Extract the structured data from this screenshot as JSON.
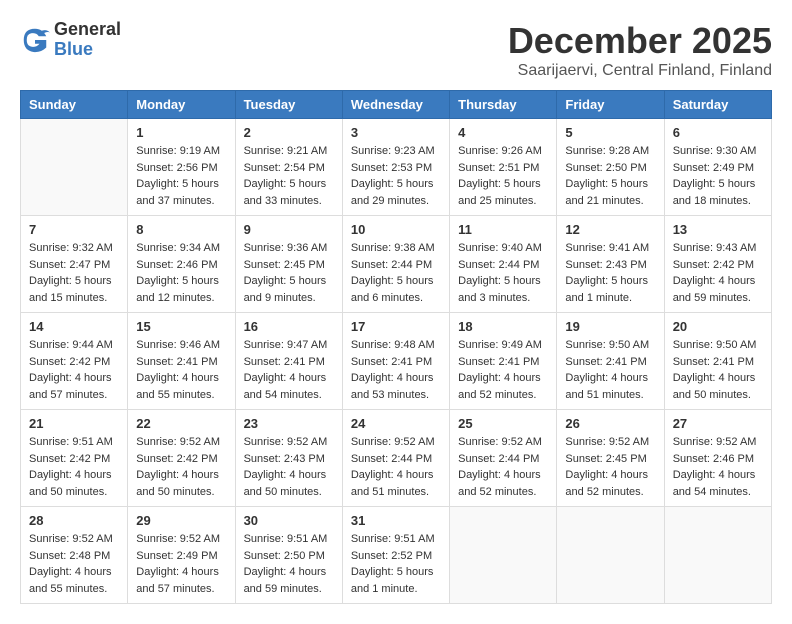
{
  "header": {
    "logo_general": "General",
    "logo_blue": "Blue",
    "title": "December 2025",
    "subtitle": "Saarijaervi, Central Finland, Finland"
  },
  "columns": [
    "Sunday",
    "Monday",
    "Tuesday",
    "Wednesday",
    "Thursday",
    "Friday",
    "Saturday"
  ],
  "weeks": [
    [
      {
        "day": "",
        "info": ""
      },
      {
        "day": "1",
        "info": "Sunrise: 9:19 AM\nSunset: 2:56 PM\nDaylight: 5 hours\nand 37 minutes."
      },
      {
        "day": "2",
        "info": "Sunrise: 9:21 AM\nSunset: 2:54 PM\nDaylight: 5 hours\nand 33 minutes."
      },
      {
        "day": "3",
        "info": "Sunrise: 9:23 AM\nSunset: 2:53 PM\nDaylight: 5 hours\nand 29 minutes."
      },
      {
        "day": "4",
        "info": "Sunrise: 9:26 AM\nSunset: 2:51 PM\nDaylight: 5 hours\nand 25 minutes."
      },
      {
        "day": "5",
        "info": "Sunrise: 9:28 AM\nSunset: 2:50 PM\nDaylight: 5 hours\nand 21 minutes."
      },
      {
        "day": "6",
        "info": "Sunrise: 9:30 AM\nSunset: 2:49 PM\nDaylight: 5 hours\nand 18 minutes."
      }
    ],
    [
      {
        "day": "7",
        "info": "Sunrise: 9:32 AM\nSunset: 2:47 PM\nDaylight: 5 hours\nand 15 minutes."
      },
      {
        "day": "8",
        "info": "Sunrise: 9:34 AM\nSunset: 2:46 PM\nDaylight: 5 hours\nand 12 minutes."
      },
      {
        "day": "9",
        "info": "Sunrise: 9:36 AM\nSunset: 2:45 PM\nDaylight: 5 hours\nand 9 minutes."
      },
      {
        "day": "10",
        "info": "Sunrise: 9:38 AM\nSunset: 2:44 PM\nDaylight: 5 hours\nand 6 minutes."
      },
      {
        "day": "11",
        "info": "Sunrise: 9:40 AM\nSunset: 2:44 PM\nDaylight: 5 hours\nand 3 minutes."
      },
      {
        "day": "12",
        "info": "Sunrise: 9:41 AM\nSunset: 2:43 PM\nDaylight: 5 hours\nand 1 minute."
      },
      {
        "day": "13",
        "info": "Sunrise: 9:43 AM\nSunset: 2:42 PM\nDaylight: 4 hours\nand 59 minutes."
      }
    ],
    [
      {
        "day": "14",
        "info": "Sunrise: 9:44 AM\nSunset: 2:42 PM\nDaylight: 4 hours\nand 57 minutes."
      },
      {
        "day": "15",
        "info": "Sunrise: 9:46 AM\nSunset: 2:41 PM\nDaylight: 4 hours\nand 55 minutes."
      },
      {
        "day": "16",
        "info": "Sunrise: 9:47 AM\nSunset: 2:41 PM\nDaylight: 4 hours\nand 54 minutes."
      },
      {
        "day": "17",
        "info": "Sunrise: 9:48 AM\nSunset: 2:41 PM\nDaylight: 4 hours\nand 53 minutes."
      },
      {
        "day": "18",
        "info": "Sunrise: 9:49 AM\nSunset: 2:41 PM\nDaylight: 4 hours\nand 52 minutes."
      },
      {
        "day": "19",
        "info": "Sunrise: 9:50 AM\nSunset: 2:41 PM\nDaylight: 4 hours\nand 51 minutes."
      },
      {
        "day": "20",
        "info": "Sunrise: 9:50 AM\nSunset: 2:41 PM\nDaylight: 4 hours\nand 50 minutes."
      }
    ],
    [
      {
        "day": "21",
        "info": "Sunrise: 9:51 AM\nSunset: 2:42 PM\nDaylight: 4 hours\nand 50 minutes."
      },
      {
        "day": "22",
        "info": "Sunrise: 9:52 AM\nSunset: 2:42 PM\nDaylight: 4 hours\nand 50 minutes."
      },
      {
        "day": "23",
        "info": "Sunrise: 9:52 AM\nSunset: 2:43 PM\nDaylight: 4 hours\nand 50 minutes."
      },
      {
        "day": "24",
        "info": "Sunrise: 9:52 AM\nSunset: 2:44 PM\nDaylight: 4 hours\nand 51 minutes."
      },
      {
        "day": "25",
        "info": "Sunrise: 9:52 AM\nSunset: 2:44 PM\nDaylight: 4 hours\nand 52 minutes."
      },
      {
        "day": "26",
        "info": "Sunrise: 9:52 AM\nSunset: 2:45 PM\nDaylight: 4 hours\nand 52 minutes."
      },
      {
        "day": "27",
        "info": "Sunrise: 9:52 AM\nSunset: 2:46 PM\nDaylight: 4 hours\nand 54 minutes."
      }
    ],
    [
      {
        "day": "28",
        "info": "Sunrise: 9:52 AM\nSunset: 2:48 PM\nDaylight: 4 hours\nand 55 minutes."
      },
      {
        "day": "29",
        "info": "Sunrise: 9:52 AM\nSunset: 2:49 PM\nDaylight: 4 hours\nand 57 minutes."
      },
      {
        "day": "30",
        "info": "Sunrise: 9:51 AM\nSunset: 2:50 PM\nDaylight: 4 hours\nand 59 minutes."
      },
      {
        "day": "31",
        "info": "Sunrise: 9:51 AM\nSunset: 2:52 PM\nDaylight: 5 hours\nand 1 minute."
      },
      {
        "day": "",
        "info": ""
      },
      {
        "day": "",
        "info": ""
      },
      {
        "day": "",
        "info": ""
      }
    ]
  ]
}
